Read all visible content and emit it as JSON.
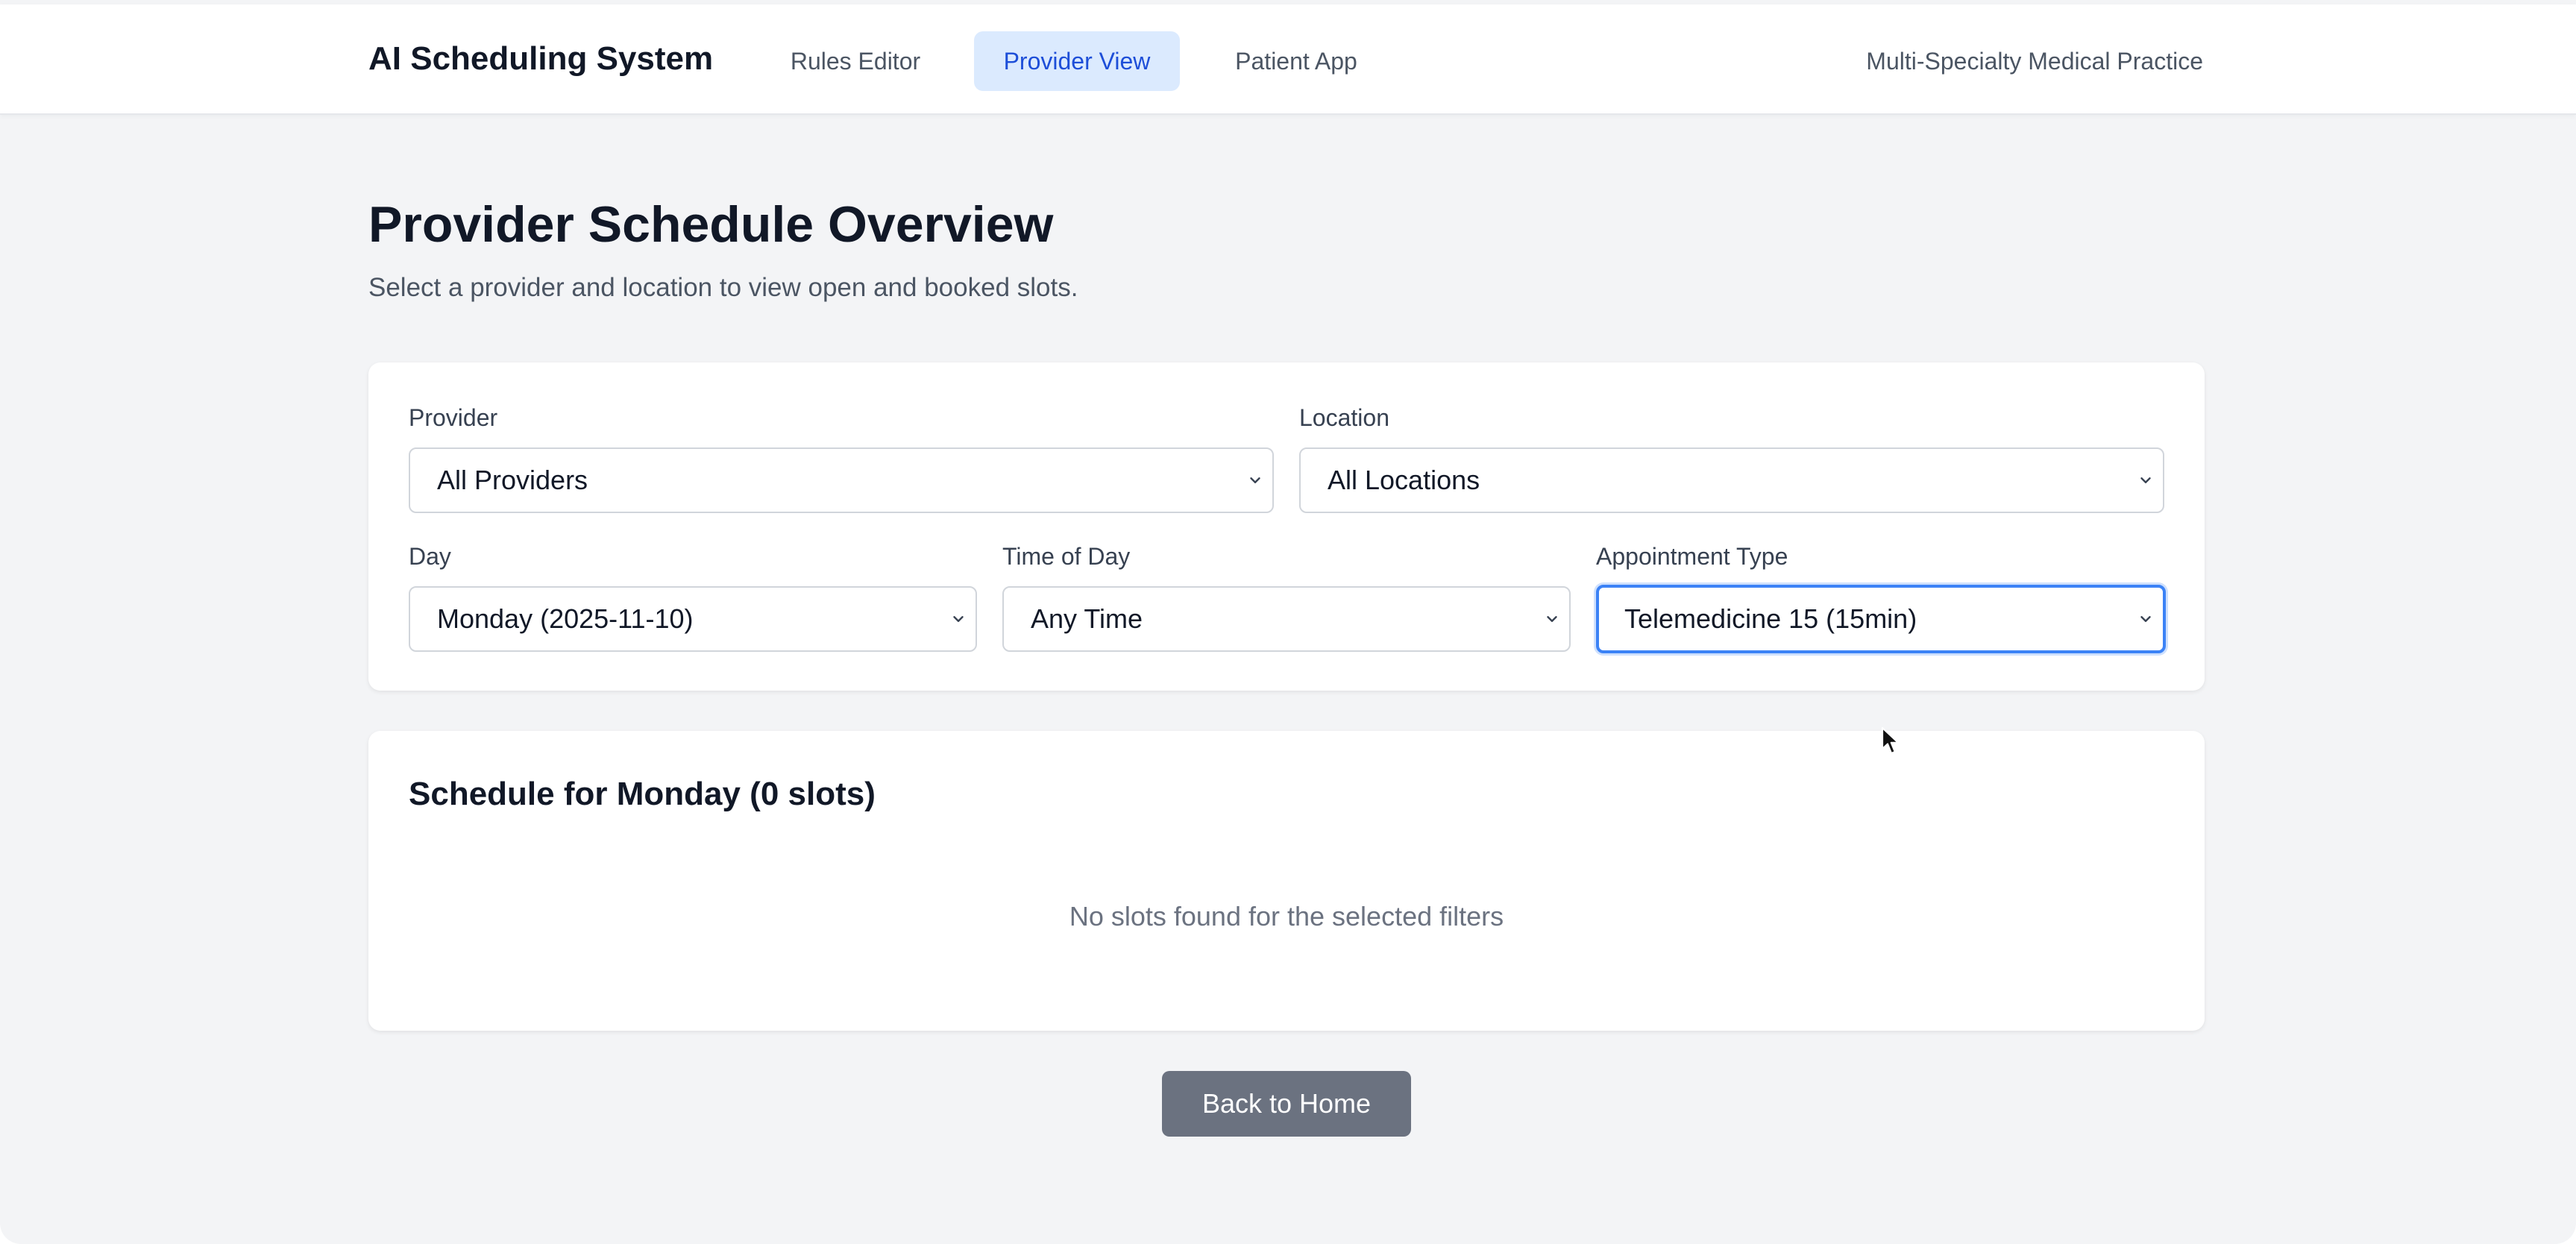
{
  "header": {
    "brand": "AI Scheduling System",
    "tabs": [
      {
        "label": "Rules Editor",
        "active": false
      },
      {
        "label": "Provider View",
        "active": true
      },
      {
        "label": "Patient App",
        "active": false
      }
    ],
    "practice": "Multi-Specialty Medical Practice"
  },
  "page": {
    "title": "Provider Schedule Overview",
    "subtitle": "Select a provider and location to view open and booked slots."
  },
  "filters": {
    "provider": {
      "label": "Provider",
      "value": "All Providers"
    },
    "location": {
      "label": "Location",
      "value": "All Locations"
    },
    "day": {
      "label": "Day",
      "value": "Monday (2025-11-10)"
    },
    "time_of_day": {
      "label": "Time of Day",
      "value": "Any Time"
    },
    "appointment_type": {
      "label": "Appointment Type",
      "value": "Telemedicine 15 (15min)",
      "focused": true
    }
  },
  "schedule": {
    "title": "Schedule for Monday (0 slots)",
    "empty_message": "No slots found for the selected filters"
  },
  "actions": {
    "back_home": "Back to Home"
  },
  "colors": {
    "accent": "#3b82f6",
    "active_tab_bg": "#dbeafe",
    "active_tab_text": "#1d4ed8",
    "button_bg": "#6b7280",
    "page_bg": "#f3f4f6"
  }
}
